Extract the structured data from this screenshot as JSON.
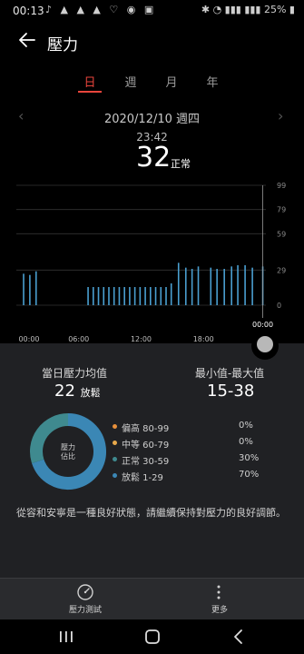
{
  "status_bar": {
    "time": "00:13",
    "battery": "25%"
  },
  "header": {
    "title": "壓力"
  },
  "tabs": [
    {
      "label": "日",
      "active": true
    },
    {
      "label": "週",
      "active": false
    },
    {
      "label": "月",
      "active": false
    },
    {
      "label": "年",
      "active": false
    }
  ],
  "date": "2020/12/10 週四",
  "selected": {
    "time": "23:42",
    "value": "32",
    "level": "正常"
  },
  "chart_data": {
    "type": "bar",
    "x_unit": "hour of day",
    "x_ticks": [
      "00:00",
      "06:00",
      "12:00",
      "18:00",
      "00:00"
    ],
    "x_range": [
      0,
      24
    ],
    "y_ticks": [
      "99",
      "79",
      "59",
      "29",
      "0"
    ],
    "y_tick_values": [
      99,
      79,
      59,
      29,
      0
    ],
    "y_range": [
      0,
      99
    ],
    "grid": true,
    "selected_x": 23.7,
    "points": [
      {
        "x": 0.7,
        "y": 26
      },
      {
        "x": 1.3,
        "y": 25
      },
      {
        "x": 1.9,
        "y": 28
      },
      {
        "x": 6.9,
        "y": 15
      },
      {
        "x": 7.4,
        "y": 15
      },
      {
        "x": 7.9,
        "y": 15
      },
      {
        "x": 8.4,
        "y": 15
      },
      {
        "x": 8.9,
        "y": 15
      },
      {
        "x": 9.4,
        "y": 15
      },
      {
        "x": 9.9,
        "y": 15
      },
      {
        "x": 10.4,
        "y": 15
      },
      {
        "x": 10.9,
        "y": 15
      },
      {
        "x": 11.4,
        "y": 15
      },
      {
        "x": 11.9,
        "y": 15
      },
      {
        "x": 12.4,
        "y": 15
      },
      {
        "x": 12.9,
        "y": 15
      },
      {
        "x": 13.4,
        "y": 15
      },
      {
        "x": 13.9,
        "y": 15
      },
      {
        "x": 14.4,
        "y": 15
      },
      {
        "x": 14.9,
        "y": 18
      },
      {
        "x": 15.6,
        "y": 35
      },
      {
        "x": 16.3,
        "y": 31
      },
      {
        "x": 16.9,
        "y": 30
      },
      {
        "x": 17.5,
        "y": 32
      },
      {
        "x": 18.7,
        "y": 31
      },
      {
        "x": 19.3,
        "y": 30
      },
      {
        "x": 20.0,
        "y": 30
      },
      {
        "x": 20.7,
        "y": 32
      },
      {
        "x": 21.3,
        "y": 33
      },
      {
        "x": 22.0,
        "y": 33
      },
      {
        "x": 22.7,
        "y": 31
      },
      {
        "x": 23.7,
        "y": 32
      }
    ],
    "colors": {
      "bar": "#4a9fd0",
      "selected_line": "#9a9a9a"
    }
  },
  "summary": {
    "avg_label": "當日壓力均值",
    "avg_value": "22",
    "avg_level": "放鬆",
    "range_label": "最小值-最大值",
    "range_value": "15-38"
  },
  "donut": {
    "center_label": "壓力\n佔比",
    "segments": [
      {
        "label": "偏高 80-99",
        "percent": 0,
        "pct_text": "0%",
        "color": "#e8903b"
      },
      {
        "label": "中等 60-79",
        "percent": 0,
        "pct_text": "0%",
        "color": "#e8a94b"
      },
      {
        "label": "正常 30-59",
        "percent": 30,
        "pct_text": "30%",
        "color": "#3f8a8f"
      },
      {
        "label": "放鬆 1-29",
        "percent": 70,
        "pct_text": "70%",
        "color": "#3b87b5"
      }
    ]
  },
  "advice": "從容和安寧是一種良好狀態，請繼續保持對壓力的良好調節。",
  "bottom_bar": {
    "test_label": "壓力測試",
    "more_label": "更多"
  }
}
